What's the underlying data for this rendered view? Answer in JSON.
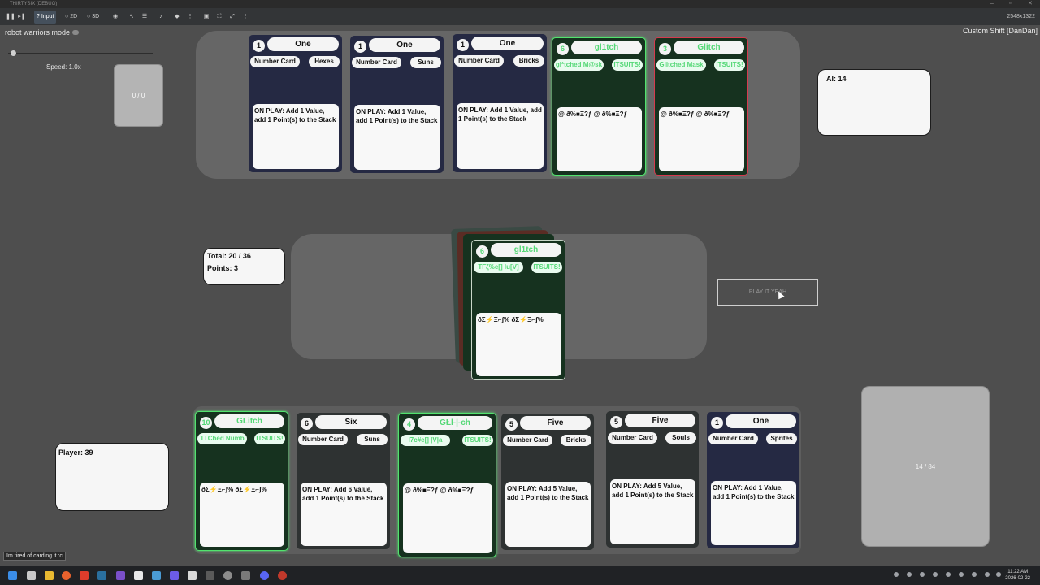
{
  "window": {
    "title": "THIRTYSIX (DEBUG)",
    "resolution": "2548x1322"
  },
  "toolbar": {
    "input_label": "Input",
    "mode_2d_label": "2D",
    "mode_3d_label": "3D"
  },
  "hud": {
    "robot_mode_label": "robot warriors mode",
    "custom_shift_label": "Custom Shift  [DanDan]",
    "speed_label": "Speed: 1.0x",
    "speed_value": 1.0,
    "counter_label": "0 / 0",
    "ai_label": "AI: 14",
    "total_label": "Total: 20 / 36",
    "points_label": "Points: 3",
    "player_label": "Player: 39",
    "play_button_label": "PLAY IT YEAH",
    "deck_label": "14 / 84",
    "status_message": "Im tired of carding it :c"
  },
  "ai_cards": [
    {
      "cost": "1",
      "name": "One",
      "type": "Number Card",
      "suit": "Hexes",
      "text": "ON PLAY: Add 1 Value, add 1 Point(s) to the Stack"
    },
    {
      "cost": "1",
      "name": "One",
      "type": "Number Card",
      "suit": "Suns",
      "text": "ON PLAY: Add 1 Value, add 1 Point(s) to the Stack"
    },
    {
      "cost": "1",
      "name": "One",
      "type": "Number Card",
      "suit": "Bricks",
      "text": "ON PLAY: Add 1 Value, add 1 Point(s) to the Stack"
    },
    {
      "cost": "6",
      "name": "gl1tch",
      "type": "gl*tched M@sk",
      "suit": "ITSUITS!",
      "text": "@ ð%■Ξ?ƒ @ ð%■Ξ?ƒ"
    },
    {
      "cost": "3",
      "name": "Glitch",
      "type": "Glitched Mask",
      "suit": "ITSUITS!",
      "text": "@ ð%■Ξ?ƒ @ ð%■Ξ?ƒ"
    }
  ],
  "stack_card": {
    "cost": "6",
    "name": "gl1tch",
    "type": "TΓζ%e[] lu[V]",
    "suit": "ITSUITS!",
    "text": "ðΣ⚡Ξ⌐ʃ% ðΣ⚡Ξ⌐ʃ%"
  },
  "hand_cards": [
    {
      "cost": "10",
      "name": "GLitch",
      "type": "1TChed Numb",
      "suit": "ITSUITS!",
      "text": "ðΣ⚡Ξ⌐ʃ% ðΣ⚡Ξ⌐ʃ%"
    },
    {
      "cost": "6",
      "name": "Six",
      "type": "Number Card",
      "suit": "Suns",
      "text": "ON PLAY: Add 6 Value, add 1 Point(s) to the Stack"
    },
    {
      "cost": "4",
      "name": "GŁl-|-ch",
      "type": "l7c#e[] |V|a",
      "suit": "ITSUITS!",
      "text": "@ ð%■Ξ?ƒ @ ð%■Ξ?ƒ"
    },
    {
      "cost": "5",
      "name": "Five",
      "type": "Number Card",
      "suit": "Bricks",
      "text": "ON PLAY: Add 5 Value, add 1 Point(s) to the Stack"
    },
    {
      "cost": "5",
      "name": "Five",
      "type": "Number Card",
      "suit": "Souls",
      "text": "ON PLAY: Add 5 Value, add 1 Point(s) to the Stack"
    },
    {
      "cost": "1",
      "name": "One",
      "type": "Number Card",
      "suit": "Sprites",
      "text": "ON PLAY: Add 1 Value, add 1 Point(s) to the Stack"
    }
  ],
  "clock": {
    "time": "11:22 AM",
    "date": "2026-02-22"
  }
}
